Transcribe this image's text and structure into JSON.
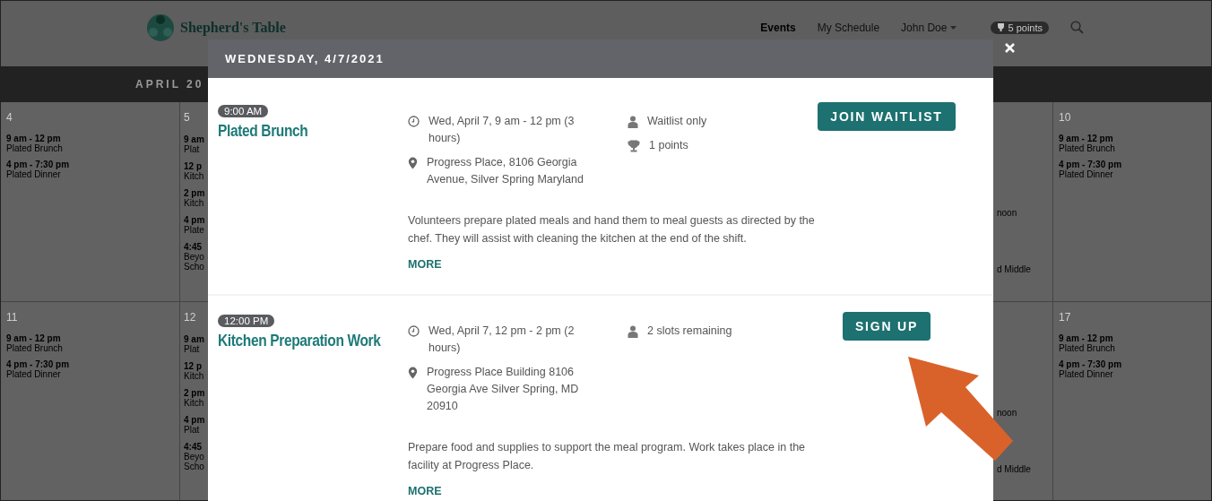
{
  "header": {
    "logo_text": "Shepherd's Table",
    "nav": [
      {
        "label": "Events",
        "selected": true
      },
      {
        "label": "My Schedule",
        "selected": false
      },
      {
        "label": "John Doe"
      }
    ],
    "points": "5 points"
  },
  "month_bar": {
    "title": "APRIL 20"
  },
  "calendar": {
    "weeks": [
      {
        "first": {
          "number": "4",
          "entries": [
            {
              "time": "9 am - 12 pm",
              "lines": [
                "Plated Brunch"
              ]
            },
            {
              "time": "4 pm - 7:30 pm",
              "lines": [
                "Plated Dinner"
              ]
            }
          ]
        },
        "second": {
          "number": "5",
          "entries": [
            {
              "time": "9 am",
              "lines": [
                "Plat"
              ]
            },
            {
              "time": "12 p",
              "lines": [
                "Kitch"
              ]
            },
            {
              "time": "2 pm",
              "lines": [
                "Kitch"
              ]
            },
            {
              "time": "4 pm",
              "lines": [
                "Plate"
              ]
            },
            {
              "time": "4:45",
              "lines": [
                "Beyo",
                "Scho"
              ]
            }
          ]
        },
        "cut": [
          "noon",
          "d Middle"
        ],
        "last": {
          "number": "10",
          "entries": [
            {
              "time": "9 am - 12 pm",
              "lines": [
                "Plated Brunch"
              ]
            },
            {
              "time": "4 pm - 7:30 pm",
              "lines": [
                "Plated Dinner"
              ]
            }
          ]
        }
      },
      {
        "first": {
          "number": "11",
          "entries": [
            {
              "time": "9 am - 12 pm",
              "lines": [
                "Plated Brunch"
              ]
            },
            {
              "time": "4 pm - 7:30 pm",
              "lines": [
                "Plated Dinner"
              ]
            }
          ]
        },
        "second": {
          "number": "12",
          "entries": [
            {
              "time": "9 am",
              "lines": [
                "Plat"
              ]
            },
            {
              "time": "12 p",
              "lines": [
                "Kitch"
              ]
            },
            {
              "time": "2 pm",
              "lines": [
                "Kitch"
              ]
            },
            {
              "time": "4 pm",
              "lines": [
                "Plat"
              ]
            },
            {
              "time": "4:45",
              "lines": [
                "Beyo",
                "Scho"
              ]
            }
          ]
        },
        "cut": [
          "noon",
          "d Middle"
        ],
        "last": {
          "number": "17",
          "entries": [
            {
              "time": "9 am - 12 pm",
              "lines": [
                "Plated Brunch"
              ]
            },
            {
              "time": "4 pm - 7:30 pm",
              "lines": [
                "Plated Dinner"
              ]
            }
          ]
        }
      }
    ]
  },
  "modal": {
    "title": "WEDNESDAY, 4/7/2021",
    "events": [
      {
        "time": "9:00 AM",
        "title": "Plated Brunch",
        "when": "Wed, April 7, 9 am - 12 pm (3 hours)",
        "where": "Progress Place, 8106 Georgia Avenue, Silver Spring Maryland",
        "slots": "Waitlist only",
        "points": "1 points",
        "description": "Volunteers prepare plated meals and hand them to meal guests as directed by the chef. They will assist with cleaning the kitchen at the end of the shift.",
        "more": "MORE",
        "action": "JOIN WAITLIST"
      },
      {
        "time": "12:00 PM",
        "title": "Kitchen Preparation Work",
        "when": "Wed, April 7, 12 pm - 2 pm (2 hours)",
        "where": "Progress Place Building 8106 Georgia Ave Silver Spring, MD 20910",
        "slots": "2 slots remaining",
        "description": "Prepare food and supplies to support the meal program. Work takes place in the facility at Progress Place.",
        "more": "MORE",
        "action": "SIGN UP"
      }
    ]
  }
}
